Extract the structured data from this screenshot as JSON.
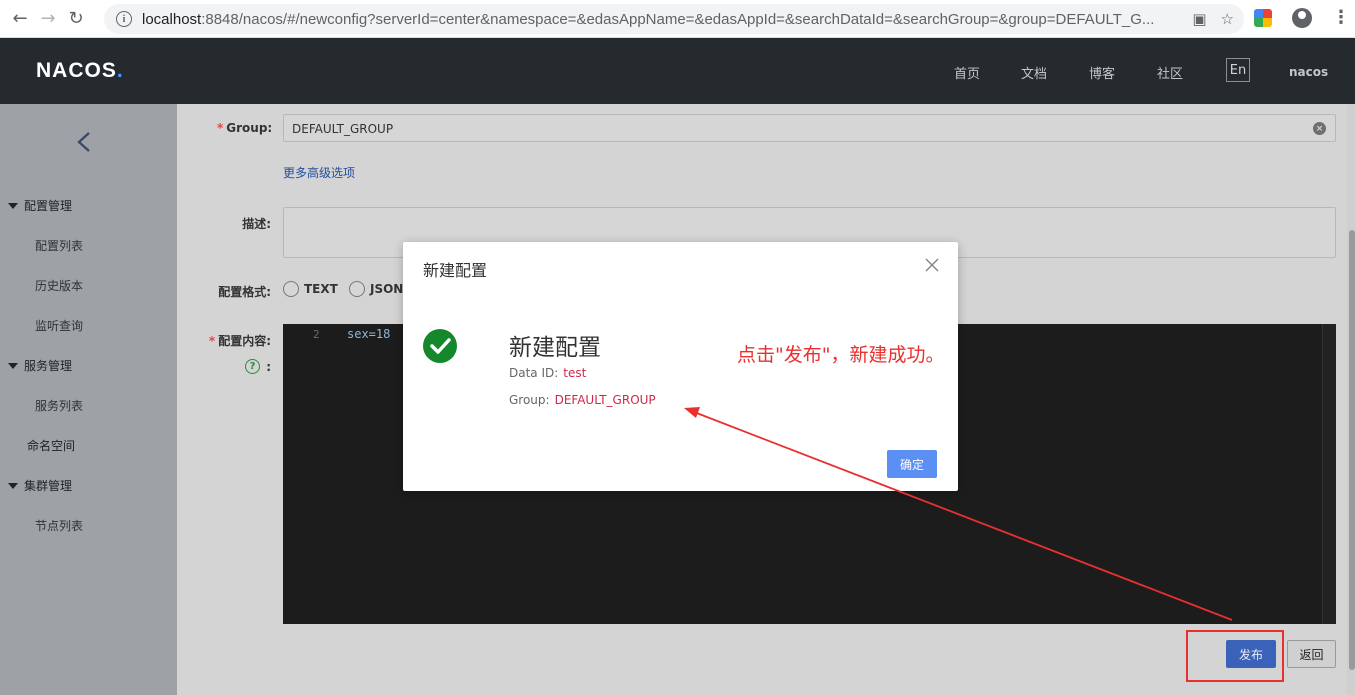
{
  "browser": {
    "url_host": "localhost",
    "url_rest": ":8848/nacos/#/newconfig?serverId=center&namespace=&edasAppName=&edasAppId=&searchDataId=&searchGroup=&group=DEFAULT_G..."
  },
  "header": {
    "logo_main": "NACOS",
    "logo_dot": ".",
    "nav": [
      "首页",
      "文档",
      "博客",
      "社区"
    ],
    "lang": "En",
    "user": "nacos"
  },
  "sidebar": {
    "groups": [
      {
        "label": "配置管理",
        "items": [
          "配置列表",
          "历史版本",
          "监听查询"
        ]
      },
      {
        "label": "服务管理",
        "items": [
          "服务列表"
        ]
      }
    ],
    "plain_item": "命名空间",
    "cluster_group": {
      "label": "集群管理",
      "items": [
        "节点列表"
      ]
    }
  },
  "form": {
    "group_label": "Group:",
    "group_value": "DEFAULT_GROUP",
    "advanced_link": "更多高级选项",
    "desc_label": "描述:",
    "format_label": "配置格式:",
    "format_options": [
      "TEXT",
      "JSON"
    ],
    "content_label": "配置内容:",
    "help_suffix": ":",
    "editor_line_number": "2",
    "editor_code": "sex=18",
    "publish_button": "发布",
    "back_button": "返回"
  },
  "dialog": {
    "title": "新建配置",
    "result_title": "新建配置",
    "data_id_label": "Data ID:",
    "data_id_value": "test",
    "group_label": "Group:",
    "group_value": "DEFAULT_GROUP",
    "ok_button": "确定"
  },
  "annotation": {
    "text": "点击\"发布\"，新建成功。",
    "color": "#e8302e"
  },
  "colors": {
    "header_bg": "#252a2f",
    "success": "#15882c",
    "primary_button": "#5b8ff3",
    "value_text": "#d0284b"
  }
}
